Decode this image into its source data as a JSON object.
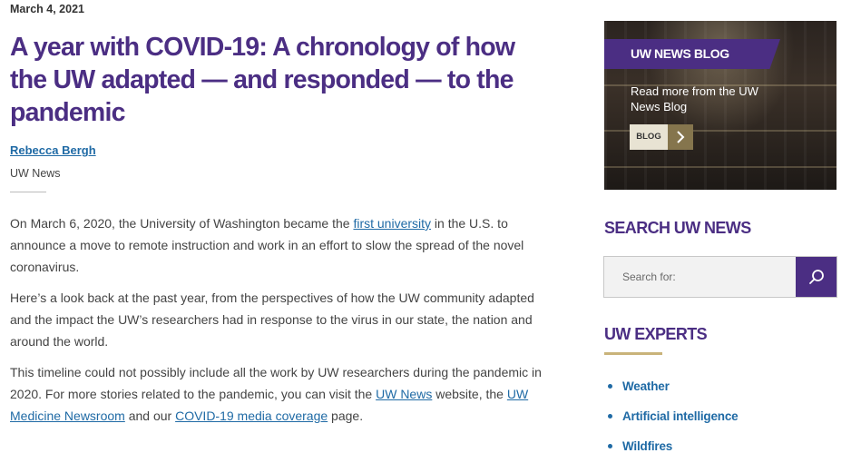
{
  "article": {
    "date": "March 4, 2021",
    "title": "A year with COVID-19: A chronology of how the UW adapted — and responded — to the pandemic",
    "author": "Rebecca Bergh",
    "source": "UW News",
    "p1": {
      "before": "On March 6, 2020, the University of Washington became the ",
      "link": "first university",
      "after": " in the U.S. to announce a move to remote instruction and work in an effort to slow the spread of the novel coronavirus."
    },
    "p2": "Here’s a look back at the past year, from the perspectives of how the UW community adapted and the impact the UW’s researchers had in response to the virus in our state, the nation and around the world.",
    "p3": {
      "before": "This timeline could not possibly include all the work by UW researchers during the pandemic in 2020. For more stories related to the pandemic, you can visit the ",
      "link1": "UW News",
      "middle": " website, the ",
      "link2": "UW Medicine Newsroom",
      "and": " and our ",
      "link3": "COVID-19 media coverage",
      "after": " page."
    }
  },
  "sidebar": {
    "blog": {
      "banner": "UW NEWS BLOG",
      "text": "Read more from the UW News Blog",
      "button_label": "BLOG",
      "button_icon": "chevron-right-icon"
    },
    "search": {
      "heading": "SEARCH UW NEWS",
      "placeholder": "Search for:",
      "button_icon": "search-icon"
    },
    "experts": {
      "heading": "UW EXPERTS",
      "items": [
        "Weather",
        "Artificial intelligence",
        "Wildfires"
      ]
    }
  },
  "colors": {
    "purple": "#4b2e83",
    "gold": "#c9b37a",
    "link": "#1f6aa5"
  }
}
